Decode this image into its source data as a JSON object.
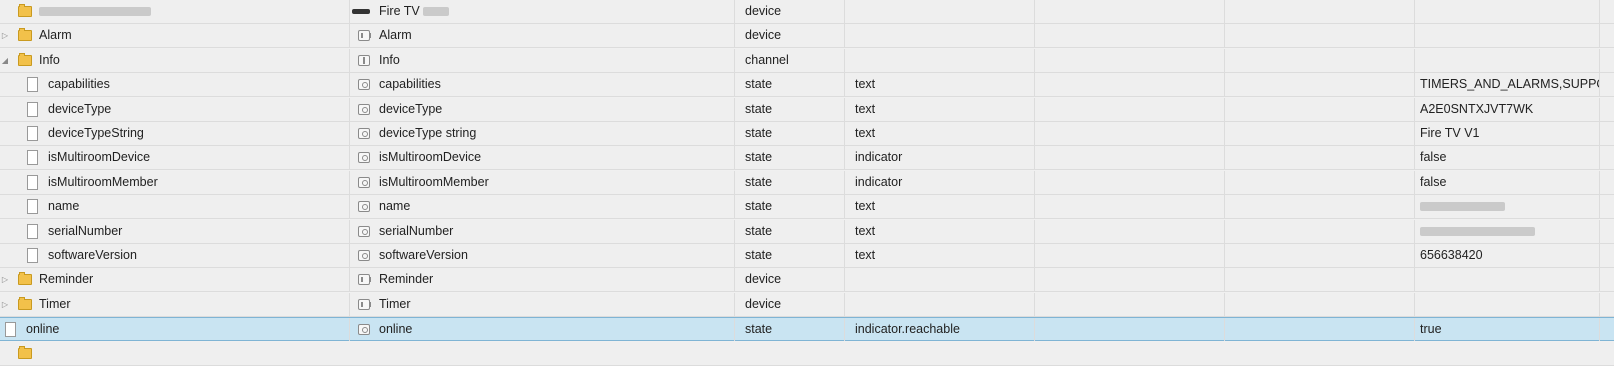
{
  "rows": [
    {
      "indent": 0,
      "kind": "folder",
      "toggle": "",
      "name": "",
      "name_blurred": true,
      "type_icon": "fire",
      "title": "Fire TV",
      "title_blurred": true,
      "obj_type": "device",
      "role": "",
      "value": "",
      "value_blurred": false
    },
    {
      "indent": 0,
      "kind": "folder",
      "toggle": "▷",
      "name": "Alarm",
      "type_icon": "device",
      "title": "Alarm",
      "obj_type": "device",
      "role": "",
      "value": ""
    },
    {
      "indent": 0,
      "kind": "folder",
      "toggle": "◢",
      "name": "Info",
      "type_icon": "channel",
      "title": "Info",
      "obj_type": "channel",
      "role": "",
      "value": ""
    },
    {
      "indent": 1,
      "kind": "file",
      "toggle": "",
      "name": "capabilities",
      "type_icon": "state",
      "title": "capabilities",
      "obj_type": "state",
      "role": "text",
      "value": "TIMERS_AND_ALARMS,SUPPOR"
    },
    {
      "indent": 1,
      "kind": "file",
      "toggle": "",
      "name": "deviceType",
      "type_icon": "state",
      "title": "deviceType",
      "obj_type": "state",
      "role": "text",
      "value": "A2E0SNTXJVT7WK"
    },
    {
      "indent": 1,
      "kind": "file",
      "toggle": "",
      "name": "deviceTypeString",
      "type_icon": "state",
      "title": "deviceType string",
      "obj_type": "state",
      "role": "text",
      "value": "Fire TV V1"
    },
    {
      "indent": 1,
      "kind": "file",
      "toggle": "",
      "name": "isMultiroomDevice",
      "type_icon": "state",
      "title": "isMultiroomDevice",
      "obj_type": "state",
      "role": "indicator",
      "value": "false"
    },
    {
      "indent": 1,
      "kind": "file",
      "toggle": "",
      "name": "isMultiroomMember",
      "type_icon": "state",
      "title": "isMultiroomMember",
      "obj_type": "state",
      "role": "indicator",
      "value": "false"
    },
    {
      "indent": 1,
      "kind": "file",
      "toggle": "",
      "name": "name",
      "type_icon": "state",
      "title": "name",
      "obj_type": "state",
      "role": "text",
      "value": "",
      "value_blurred": true
    },
    {
      "indent": 1,
      "kind": "file",
      "toggle": "",
      "name": "serialNumber",
      "type_icon": "state",
      "title": "serialNumber",
      "obj_type": "state",
      "role": "text",
      "value": "",
      "value_blurred": true
    },
    {
      "indent": 1,
      "kind": "file",
      "toggle": "",
      "name": "softwareVersion",
      "type_icon": "state",
      "title": "softwareVersion",
      "obj_type": "state",
      "role": "text",
      "value": "656638420"
    },
    {
      "indent": 0,
      "kind": "folder",
      "toggle": "▷",
      "name": "Reminder",
      "type_icon": "device",
      "title": "Reminder",
      "obj_type": "device",
      "role": "",
      "value": ""
    },
    {
      "indent": 0,
      "kind": "folder",
      "toggle": "▷",
      "name": "Timer",
      "type_icon": "device",
      "title": "Timer",
      "obj_type": "device",
      "role": "",
      "value": ""
    },
    {
      "indent": 0,
      "kind": "file",
      "toggle": "",
      "name": "online",
      "type_icon": "state",
      "title": "online",
      "obj_type": "state",
      "role": "indicator.reachable",
      "value": "true",
      "selected": true
    }
  ]
}
